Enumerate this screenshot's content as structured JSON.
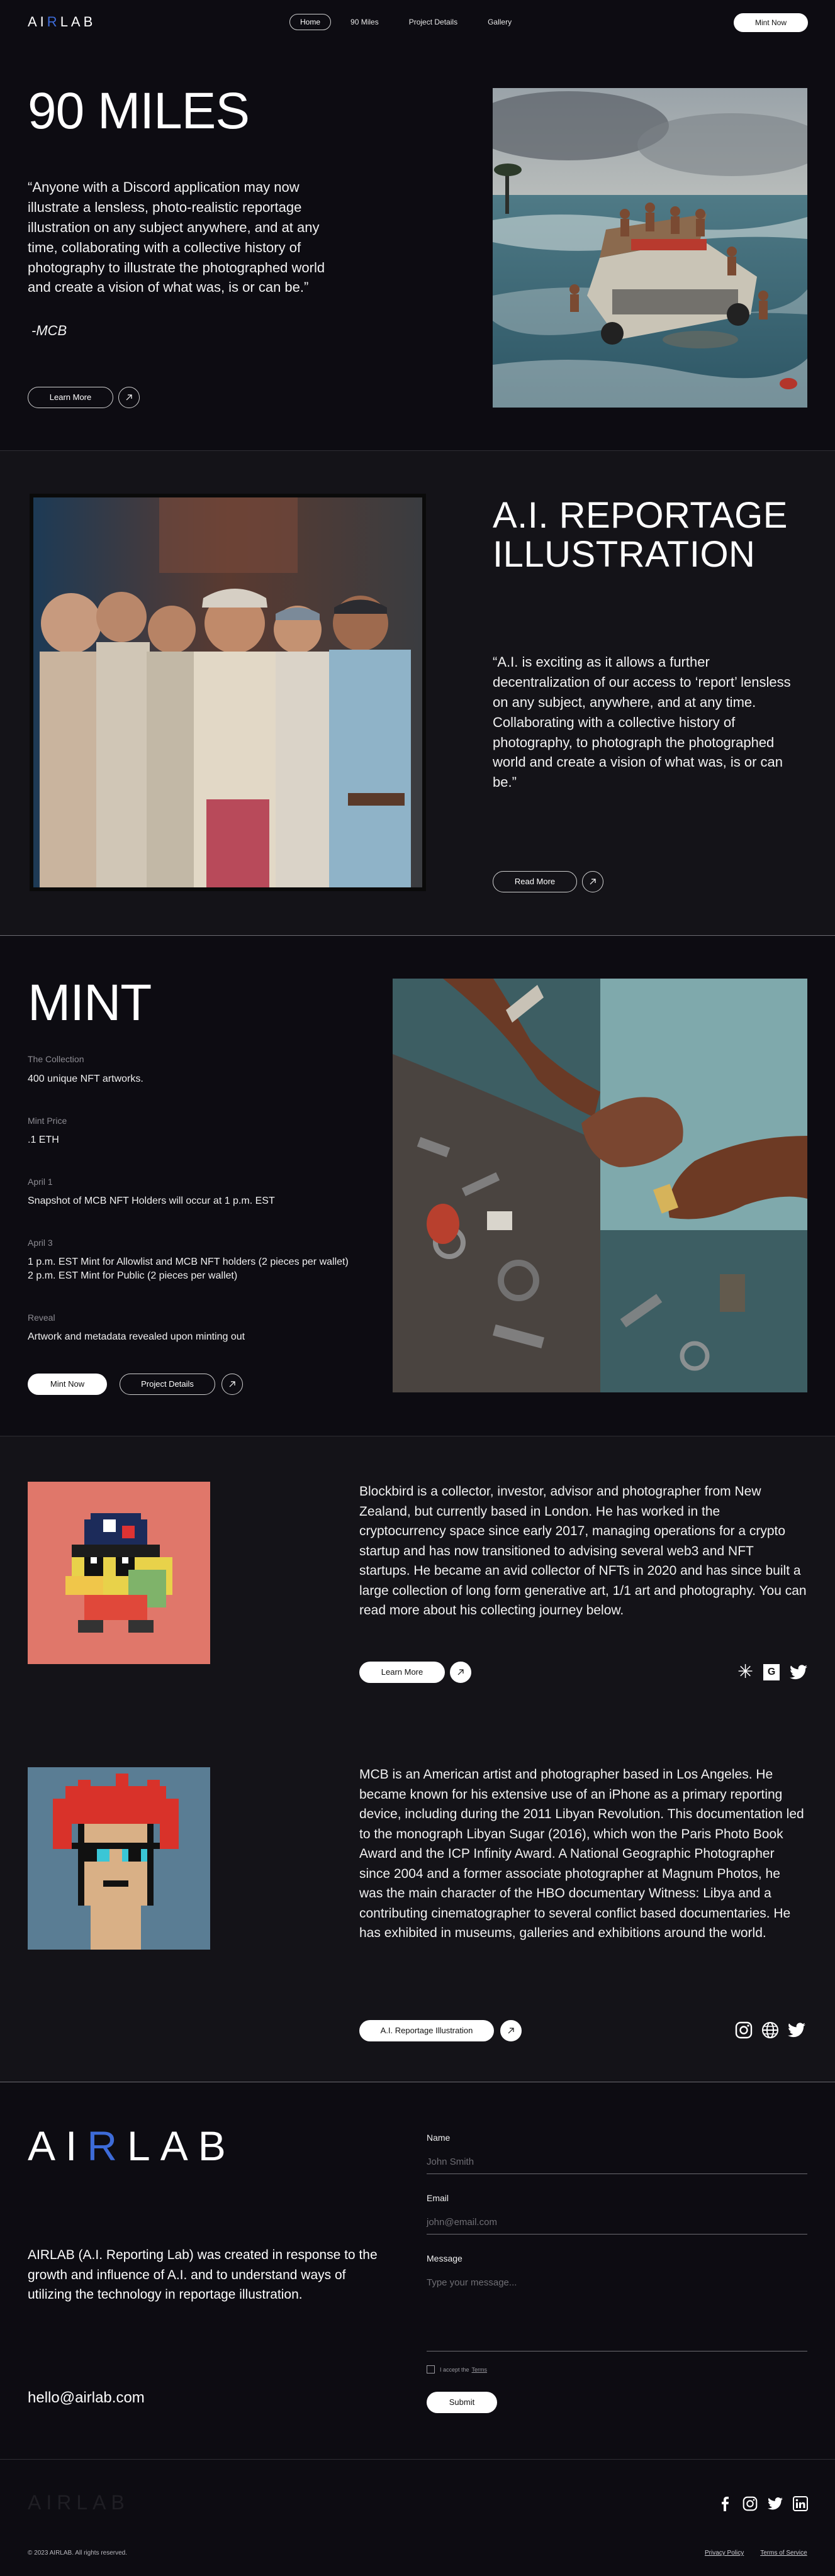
{
  "nav": {
    "logo": {
      "part1": "AI",
      "part2": "R",
      "part3": "LAB"
    },
    "links": [
      "Home",
      "90 Miles",
      "Project Details",
      "Gallery"
    ],
    "cta": "Mint Now"
  },
  "hero": {
    "title": "90 MILES",
    "quote": "“Anyone with a Discord application may now illustrate a lensless, photo-realistic reportage illustration on any subject anywhere, and at any time, collaborating with a collective history of photography to illustrate the photographed world and create a vision of what was, is or can be.”",
    "author": "-MCB",
    "button": "Learn More"
  },
  "reportage": {
    "title_line1": "A.I. REPORTAGE",
    "title_line2": "ILLUSTRATION",
    "quote": "“A.I. is exciting as it allows a further decentralization of our access to ‘report’ lensless on any subject, anywhere, and at any time. Collaborating with a collective history of photography, to photograph the photographed world and create a vision of what was, is or can be.”",
    "button": "Read More"
  },
  "mint": {
    "title": "MINT",
    "items": [
      {
        "label": "The Collection",
        "value": "400 unique NFT artworks."
      },
      {
        "label": "Mint Price",
        "value": ".1 ETH"
      },
      {
        "label": "April 1",
        "value": "Snapshot of MCB NFT Holders will occur at 1 p.m. EST"
      },
      {
        "label": "April 3",
        "value": "1 p.m. EST Mint for Allowlist and MCB NFT holders (2 pieces per wallet)\n2 p.m. EST Mint for Public (2 pieces per wallet)"
      },
      {
        "label": "Reveal",
        "value": "Artwork and metadata revealed upon minting out"
      }
    ],
    "mint_button": "Mint Now",
    "details_button": "Project Details"
  },
  "team": [
    {
      "bio": "Blockbird is a collector, investor, advisor and photographer from New Zealand, but currently based in London. He has worked in the cryptocurrency space since early 2017, managing operations for a crypto startup and has now transitioned to advising several web3 and NFT startups. He became an avid collector of NFTs in 2020 and has since built a large collection of long form generative art, 1/1 art and photography. You can read more about his collecting journey below.",
      "button": "Learn More",
      "social_icons": [
        "asterisk-icon",
        "g-badge-icon",
        "twitter-icon"
      ],
      "avatar_bg": "#e0776a"
    },
    {
      "bio": "MCB is an American artist and photographer based in Los Angeles. He became known for his extensive use of an iPhone as a primary reporting device, including during the 2011 Libyan Revolution. This documentation led to the monograph Libyan Sugar (2016), which won the Paris Photo Book Award and the ICP Infinity Award. A National Geographic Photographer since 2004 and a former associate photographer at Magnum Photos, he was the main character of the HBO documentary Witness: Libya and a contributing cinematographer to several conflict based documentaries. He has exhibited in museums, galleries and exhibitions around the world.",
      "button": "A.I. Reportage Illustration",
      "social_icons": [
        "instagram-icon",
        "globe-icon",
        "twitter-icon"
      ],
      "avatar_bg": "#5a7d94"
    }
  ],
  "contact": {
    "description": "AIRLAB (A.I. Reporting Lab) was created in response to the growth and influence of A.I. and to understand ways of utilizing the technology in reportage illustration.",
    "email": "hello@airlab.com",
    "form": {
      "name_label": "Name",
      "name_placeholder": "John Smith",
      "email_label": "Email",
      "email_placeholder": "john@email.com",
      "message_label": "Message",
      "message_placeholder": "Type your message...",
      "terms_text": "I accept the",
      "terms_link": "Terms",
      "submit": "Submit"
    }
  },
  "footer": {
    "copyright": "© 2023 AIRLAB. All rights reserved.",
    "links": [
      "Privacy Policy",
      "Terms of Service"
    ],
    "social_icons": [
      "facebook-icon",
      "instagram-icon",
      "twitter-icon",
      "linkedin-icon"
    ]
  },
  "colors": {
    "background": "#0d0c12",
    "section_alt": "#141318",
    "accent_blue": "#3d6bd8"
  }
}
